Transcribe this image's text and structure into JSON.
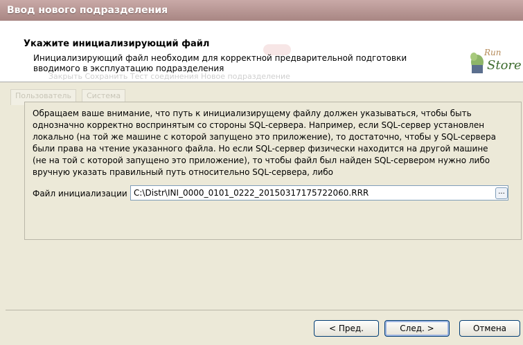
{
  "window": {
    "title": "Ввод нового подразделения"
  },
  "header": {
    "title": "Укажите инициализирующий файл",
    "description": "Инициализирующий файл необходим для корректной предварительной подготовки вводимого в эксплуатацию подразделения",
    "logo_text": "Store",
    "background_ghost_text": "Закрыть    Сохранить    Тест соединения    Новое подразделение"
  },
  "background_tabs": [
    "Пользователь",
    "Система"
  ],
  "info_text": "Обращаем ваше внимание, что путь к инициализирущему файлу должен указываться, чтобы быть однозначно корректно воспринятым со стороны SQL-сервера. Например, если SQL-сервер установлен локально (на той же машине с которой запущено это приложение), то достаточно, чтобы у SQL-сервера были права на чтение указанного файла. Но если SQL-сервер физически находится на другой машине (не на той с которой запущено это приложение), то чтобы файл был найден SQL-сервером нужно либо вручную указать правильный путь относительно SQL-сервера, либо",
  "file_field": {
    "label": "Файл инициализации",
    "value": "C:\\Distr\\INI_0000_0101_0222_20150317175722060.RRR",
    "browse_label": "..."
  },
  "buttons": {
    "prev": "< Пред.",
    "next": "След. >",
    "cancel": "Отмена"
  }
}
